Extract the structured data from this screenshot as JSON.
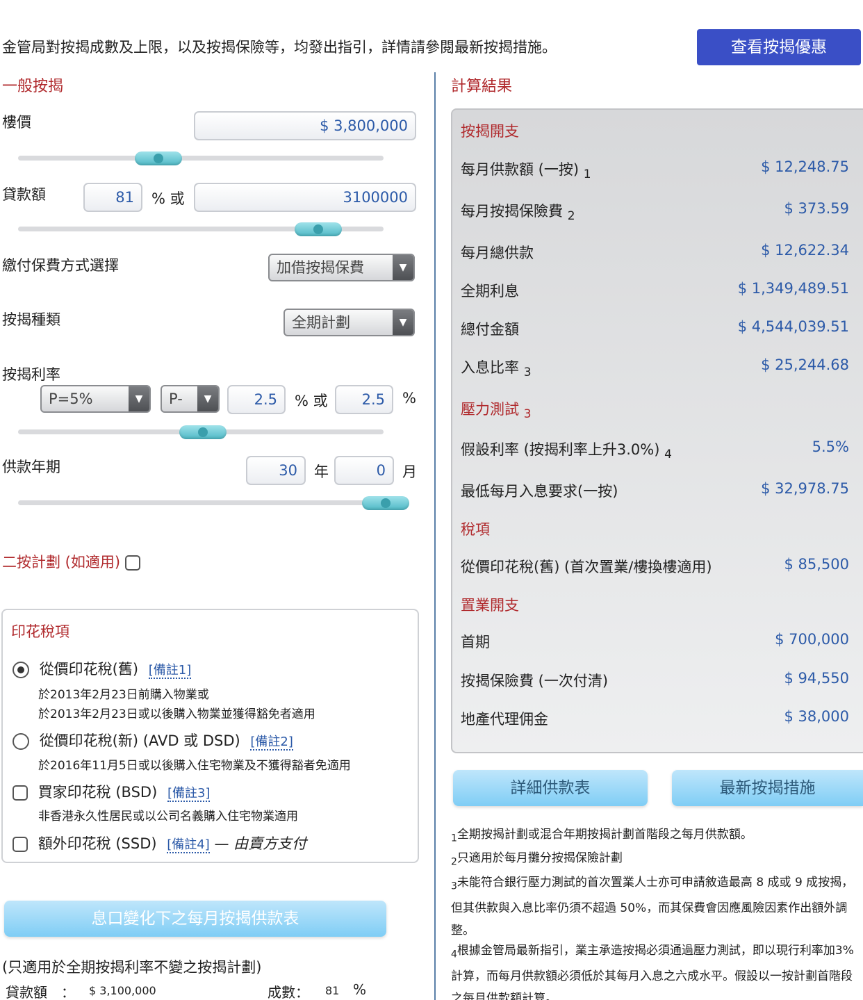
{
  "header": {
    "notice": "金管局對按揭成數及上限，以及按揭保險等，均發出指引，詳情請參閱最新按揭措施。",
    "offer_button": "查看按揭優惠"
  },
  "left": {
    "section_title": "一般按揭",
    "price_label": "樓價",
    "price_value": "$ 3,800,000",
    "loan_label": "貸款額",
    "loan_pct": "81",
    "pct_or": "% 或",
    "loan_amount": "3100000",
    "premium_label": "繳付保費方式選擇",
    "premium_select": "加借按揭保費",
    "type_label": "按揭種類",
    "type_select": "全期計劃",
    "rate_label": "按揭利率",
    "rate_base_select": "P=5%",
    "rate_op_select": "P-",
    "rate_margin": "2.5",
    "rate_or": "% 或",
    "rate_effective": "2.5",
    "rate_pct": "%",
    "term_label": "供款年期",
    "term_years": "30",
    "term_year_unit": "年",
    "term_months": "0",
    "term_month_unit": "月",
    "second_mortgage": "二按計劃 (如適用)",
    "stamp_title": "印花稅項",
    "stamp_items": [
      {
        "label": "從價印花稅(舊)",
        "note": "[備註1]",
        "desc1": "於2013年2月23日前購入物業或",
        "desc2": "於2013年2月23日或以後購入物業並獲得豁免者適用"
      },
      {
        "label": "從價印花稅(新) (AVD 或 DSD)",
        "note": "[備註2]",
        "desc1": "於2016年11月5日或以後購入住宅物業及不獲得豁者免適用"
      },
      {
        "label": "買家印花稅 (BSD)",
        "note": "[備註3]",
        "desc1": "非香港永久性居民或以公司名義購入住宅物業適用"
      },
      {
        "label": "額外印花稅 (SSD)",
        "note": "[備註4]",
        "dash": "—",
        "seller": "由賣方支付"
      }
    ],
    "table_button": "息口變化下之每月按揭供款表",
    "table_note": "(只適用於全期按揭利率不變之按揭計劃)",
    "summary_loan_label": "貸款額",
    "summary_colon": "：",
    "summary_loan_value": "$ 3,100,000",
    "summary_ratio_label": "成數：",
    "summary_ratio_value": "81",
    "summary_ratio_unit": "%"
  },
  "right": {
    "section_title": "計算結果",
    "mortgage_title": "按揭開支",
    "rows": [
      {
        "label": "每月供款額 (一按)",
        "sub": "1",
        "value": "$ 12,248.75"
      },
      {
        "label": "每月按揭保險費",
        "sub": "2",
        "value": "$ 373.59"
      },
      {
        "label": "每月總供款",
        "value": "$ 12,622.34"
      },
      {
        "label": "全期利息",
        "value": "$ 1,349,489.51"
      },
      {
        "label": "總付金額",
        "value": "$ 4,544,039.51"
      },
      {
        "label": "入息比率",
        "sub": "3",
        "value": "$ 25,244.68"
      }
    ],
    "stress_title": "壓力測試",
    "stress_sub": "3",
    "stress_rows": [
      {
        "label": "假設利率 (按揭利率上升3.0%)",
        "sub": "4",
        "value": "5.5%"
      },
      {
        "label": "最低每月入息要求(一按)",
        "value": "$ 32,978.75"
      }
    ],
    "tax_title": "稅項",
    "tax_rows": [
      {
        "label": "從價印花稅(舊) (首次置業/樓換樓適用)",
        "value": "$ 85,500"
      }
    ],
    "purchase_title": "置業開支",
    "purchase_rows": [
      {
        "label": "首期",
        "value": "$ 700,000"
      },
      {
        "label": "按揭保險費 (一次付清)",
        "value": "$ 94,550"
      },
      {
        "label": "地產代理佣金",
        "value": "$ 38,000"
      }
    ],
    "detail_button": "詳細供款表",
    "latest_button": "最新按揭措施",
    "footnotes": [
      {
        "n": "1",
        "text": "全期按揭計劃或混合年期按揭計劃首階段之每月供款額。"
      },
      {
        "n": "2",
        "text": "只適用於每月攤分按揭保險計劃"
      },
      {
        "n": "3",
        "text": "未能符合銀行壓力測試的首次置業人士亦可申請敘造最高 8 成或 9 成按揭，但其供款與入息比率仍須不超過 50%，而其保費會因應風險因素作出額外調整。"
      },
      {
        "n": "4",
        "text": "根據金管局最新指引，業主承造按揭必須通過壓力測試，即以現行利率加3%計算，而每月供款額必須低於其每月入息之六成水平。假設以一按計劃首階段之每月供款額計算。"
      }
    ]
  }
}
